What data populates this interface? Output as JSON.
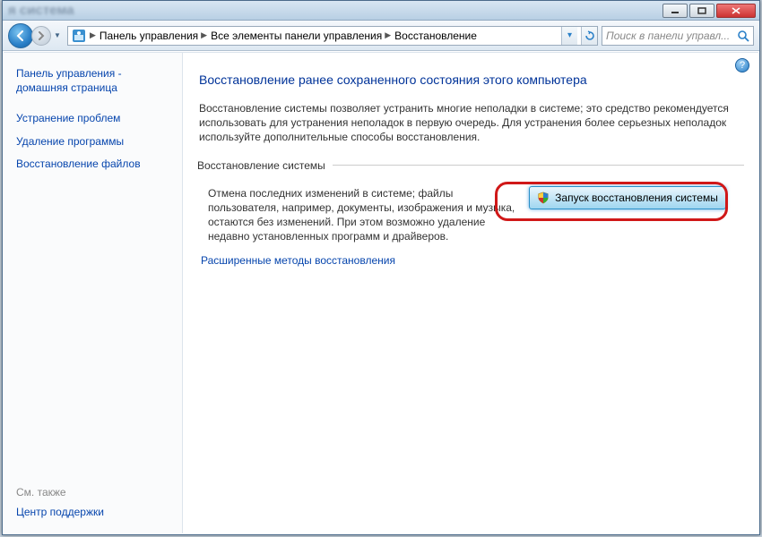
{
  "titlebar": {
    "blurred_text": "я система"
  },
  "nav": {
    "crumbs": [
      "Панель управления",
      "Все элементы панели управления",
      "Восстановление"
    ],
    "search_placeholder": "Поиск в панели управл..."
  },
  "sidebar": {
    "home_link": "Панель управления - домашняя страница",
    "links": [
      "Устранение проблем",
      "Удаление программы",
      "Восстановление файлов"
    ],
    "see_also_label": "См. также",
    "see_also_link": "Центр поддержки"
  },
  "main": {
    "heading": "Восстановление ранее сохраненного состояния этого компьютера",
    "intro": "Восстановление системы позволяет устранить многие неполадки в системе; это средство рекомендуется использовать для устранения неполадок в первую очередь. Для устранения более серьезных неполадок используйте дополнительные способы восстановления.",
    "group_title": "Восстановление системы",
    "group_text": "Отмена последних изменений в системе; файлы пользователя, например, документы, изображения и музыка, остаются без изменений. При этом возможно удаление недавно установленных программ и драйверов.",
    "restore_button": "Запуск восстановления системы",
    "advanced_link": "Расширенные методы восстановления"
  }
}
